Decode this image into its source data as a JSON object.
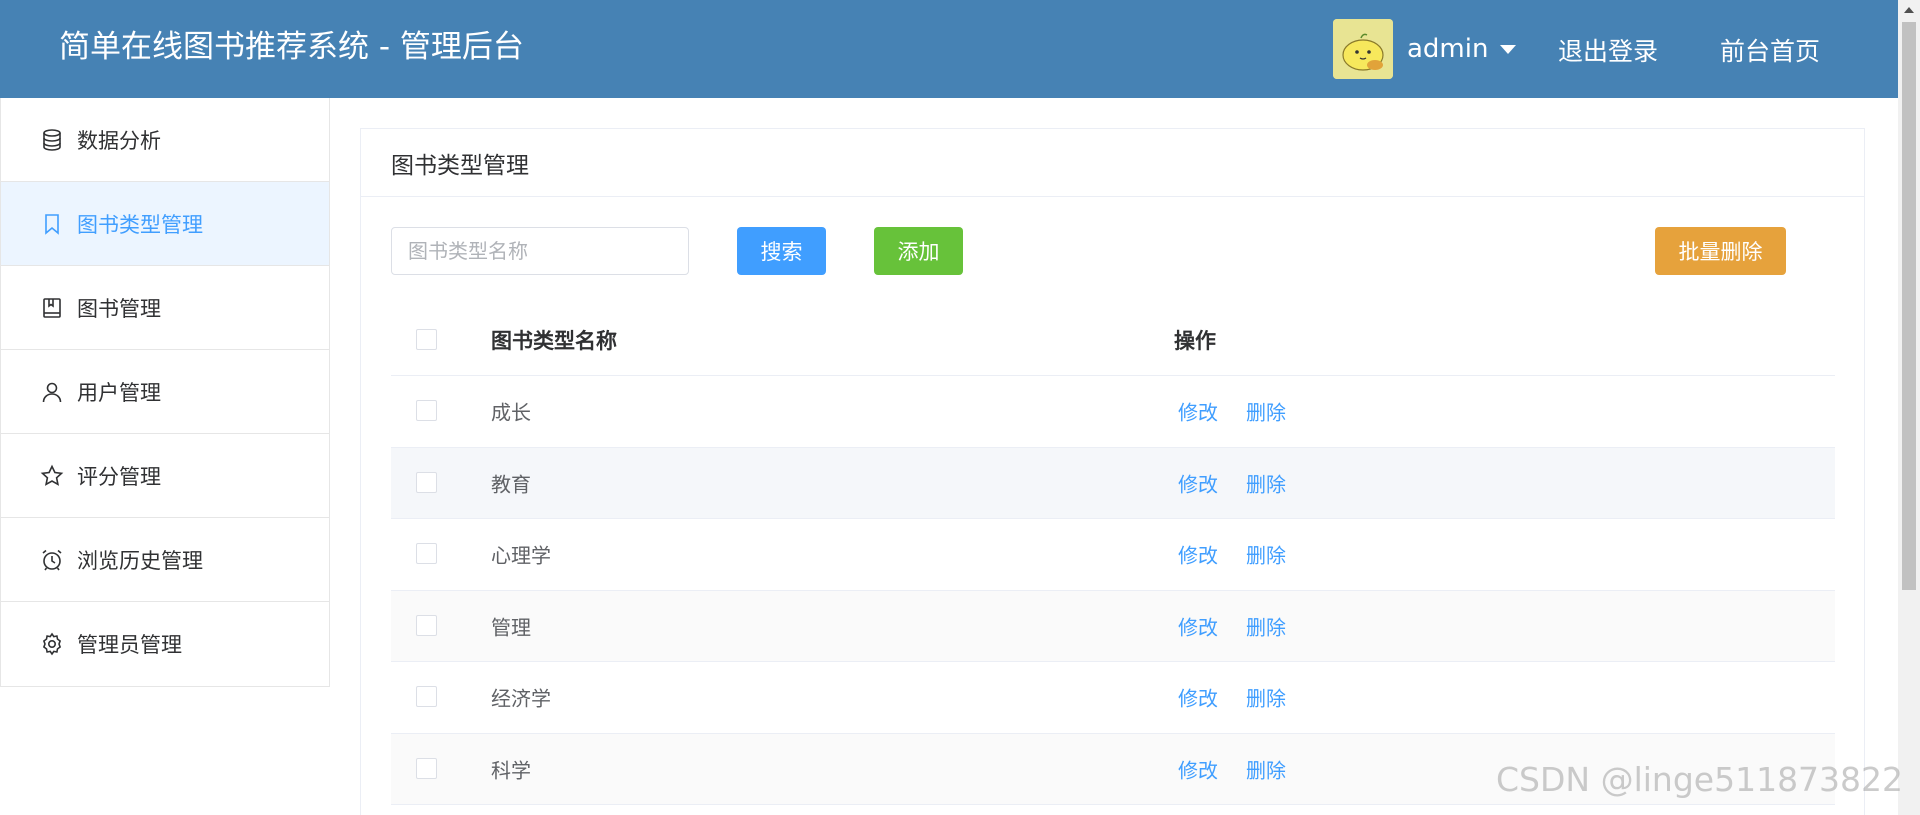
{
  "header": {
    "title": "简单在线图书推荐系统 - 管理后台",
    "username": "admin",
    "logout": "退出登录",
    "home": "前台首页",
    "bg_color": "#4682b4"
  },
  "sidebar": {
    "items": [
      {
        "label": "数据分析",
        "icon": "database-icon"
      },
      {
        "label": "图书类型管理",
        "icon": "bookmark-icon"
      },
      {
        "label": "图书管理",
        "icon": "book-icon"
      },
      {
        "label": "用户管理",
        "icon": "user-icon"
      },
      {
        "label": "评分管理",
        "icon": "star-icon"
      },
      {
        "label": "浏览历史管理",
        "icon": "alarm-clock-icon"
      },
      {
        "label": "管理员管理",
        "icon": "gear-icon"
      }
    ],
    "active_index": 1
  },
  "main": {
    "card_title": "图书类型管理",
    "search": {
      "placeholder": "图书类型名称",
      "value": ""
    },
    "buttons": {
      "search": "搜索",
      "add": "添加",
      "batch_delete": "批量删除"
    },
    "table": {
      "headers": {
        "name": "图书类型名称",
        "op": "操作"
      },
      "rows": [
        {
          "name": "成长",
          "edit": "修改",
          "delete": "删除"
        },
        {
          "name": "教育",
          "edit": "修改",
          "delete": "删除"
        },
        {
          "name": "心理学",
          "edit": "修改",
          "delete": "删除"
        },
        {
          "name": "管理",
          "edit": "修改",
          "delete": "删除"
        },
        {
          "name": "经济学",
          "edit": "修改",
          "delete": "删除"
        },
        {
          "name": "科学",
          "edit": "修改",
          "delete": "删除"
        }
      ]
    }
  },
  "watermark": "CSDN @linge511873822"
}
